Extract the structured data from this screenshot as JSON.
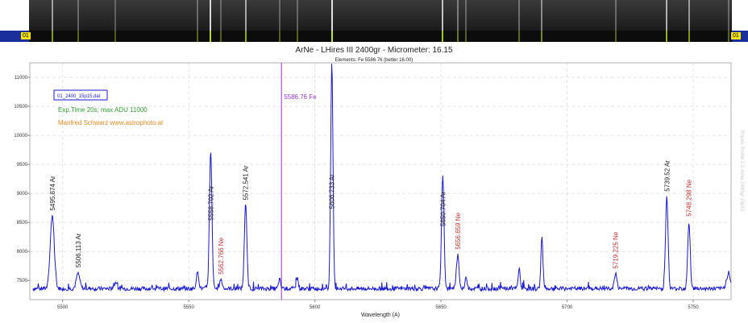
{
  "strip": {
    "left_tag": "01",
    "right_tag": "01"
  },
  "chart_data": {
    "type": "line",
    "title": "ArNe - LHires III 2400gr - Micrometer: 16.15",
    "subtitle": "Elements: Fe 5586.76 (better 16.00)",
    "xlabel": "Wavelength (A)",
    "ylabel": "",
    "xlim": [
      5487,
      5765
    ],
    "ylim": [
      7170,
      11250
    ],
    "xticks": [
      5500,
      5550,
      5600,
      5650,
      5700,
      5750
    ],
    "xtick_labels": [
      "5500",
      "5550",
      "5600",
      "5650",
      "5700",
      "5750"
    ],
    "yticks": [
      7500,
      8000,
      8500,
      9000,
      9500,
      10000,
      10500,
      11000
    ],
    "ytick_labels": [
      "7500",
      "8000",
      "8500",
      "9000",
      "9500",
      "10000",
      "10500",
      "11000"
    ],
    "grid": true,
    "series_color": "#1a1ad0",
    "baseline": 7360,
    "peaks": [
      {
        "x": 5495.874,
        "y": 8600,
        "w": 0.8
      },
      {
        "x": 5506.113,
        "y": 7620,
        "w": 0.7
      },
      {
        "x": 5521.0,
        "y": 7470,
        "w": 0.5
      },
      {
        "x": 5553.5,
        "y": 7640,
        "w": 0.5
      },
      {
        "x": 5558.702,
        "y": 9700,
        "w": 0.5
      },
      {
        "x": 5562.766,
        "y": 7520,
        "w": 0.5
      },
      {
        "x": 5572.541,
        "y": 8800,
        "w": 0.5
      },
      {
        "x": 5586.0,
        "y": 7520,
        "w": 0.4
      },
      {
        "x": 5593.0,
        "y": 7560,
        "w": 0.4
      },
      {
        "x": 5606.733,
        "y": 11250,
        "w": 0.45
      },
      {
        "x": 5650.704,
        "y": 9300,
        "w": 0.5
      },
      {
        "x": 5656.659,
        "y": 7950,
        "w": 0.5
      },
      {
        "x": 5660.0,
        "y": 7560,
        "w": 0.4
      },
      {
        "x": 5681.0,
        "y": 7700,
        "w": 0.4
      },
      {
        "x": 5690.0,
        "y": 8250,
        "w": 0.4
      },
      {
        "x": 5719.225,
        "y": 7620,
        "w": 0.5
      },
      {
        "x": 5739.52,
        "y": 8950,
        "w": 0.5
      },
      {
        "x": 5748.298,
        "y": 8500,
        "w": 0.5
      },
      {
        "x": 5764.0,
        "y": 7620,
        "w": 0.8
      }
    ],
    "line_labels": [
      {
        "x": 5495.874,
        "y": 8620,
        "text": "5495.874 Ar",
        "color": "#222222"
      },
      {
        "x": 5506.113,
        "y": 7640,
        "text": "5506.113 Ar",
        "color": "#222222"
      },
      {
        "x": 5558.702,
        "y": 8450,
        "text": "5558.702 Ar",
        "color": "#222222"
      },
      {
        "x": 5562.766,
        "y": 7520,
        "text": "5562.766 Ne",
        "color": "#c03030"
      },
      {
        "x": 5572.541,
        "y": 8800,
        "text": "5572.541 Ar",
        "color": "#222222"
      },
      {
        "x": 5606.733,
        "y": 8650,
        "text": "5606.733 Ar",
        "color": "#222222"
      },
      {
        "x": 5650.704,
        "y": 8350,
        "text": "5650.704 Ar",
        "color": "#222222"
      },
      {
        "x": 5656.659,
        "y": 7950,
        "text": "5656.659 Ne",
        "color": "#c03030"
      },
      {
        "x": 5719.225,
        "y": 7620,
        "text": "5719.225 Ne",
        "color": "#c03030"
      },
      {
        "x": 5739.52,
        "y": 8950,
        "text": "5739.52 Ar",
        "color": "#222222"
      },
      {
        "x": 5748.298,
        "y": 8520,
        "text": "5748.298 Ne",
        "color": "#c03030"
      }
    ],
    "marker": {
      "x": 5586.76,
      "label": "5586.76 Fe",
      "color": "#9933cc"
    },
    "annotations": {
      "file": "01_2400_15p15.dat",
      "exposure": "Exp.Time 20s; max ADU 11000",
      "author": "Manfred Schwarz www.astrophoto.at",
      "side_note": "RSpec Profile 1.0 ArNe 2400gr 15p15"
    }
  }
}
